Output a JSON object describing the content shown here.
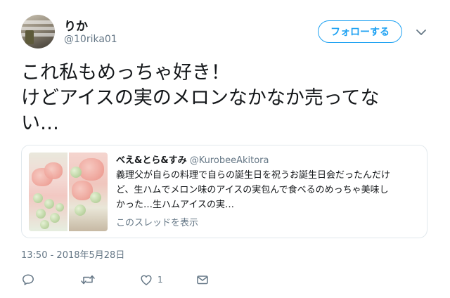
{
  "user": {
    "display_name": "りか",
    "handle": "@10rika01"
  },
  "follow_button": {
    "label": "フォローする"
  },
  "tweet": {
    "text_lines": [
      "これ私もめっちゃ好き！",
      "けどアイスの実のメロンなかなか売ってな",
      "い…"
    ]
  },
  "quote": {
    "name": "べえ&とら&すみ",
    "handle": "@KurobeeAkitora",
    "text_lines": [
      "義理父が自らの料理で自らの誕生日を祝うお誕生日会だったんだけ",
      "ど、生ハムでメロン味のアイスの実包んで食べるのめっちゃ美味し",
      "かった…生ハムアイスの実…"
    ],
    "thread_link": "このスレッドを表示"
  },
  "timestamp": "13:50 - 2018年5月28日",
  "actions": {
    "like_count": "1",
    "icons": [
      "reply-icon",
      "retweet-icon",
      "like-icon",
      "message-icon"
    ]
  },
  "colors": {
    "accent": "#1da1f2",
    "text": "#14171a",
    "muted": "#657786",
    "border": "#e1e8ed"
  }
}
